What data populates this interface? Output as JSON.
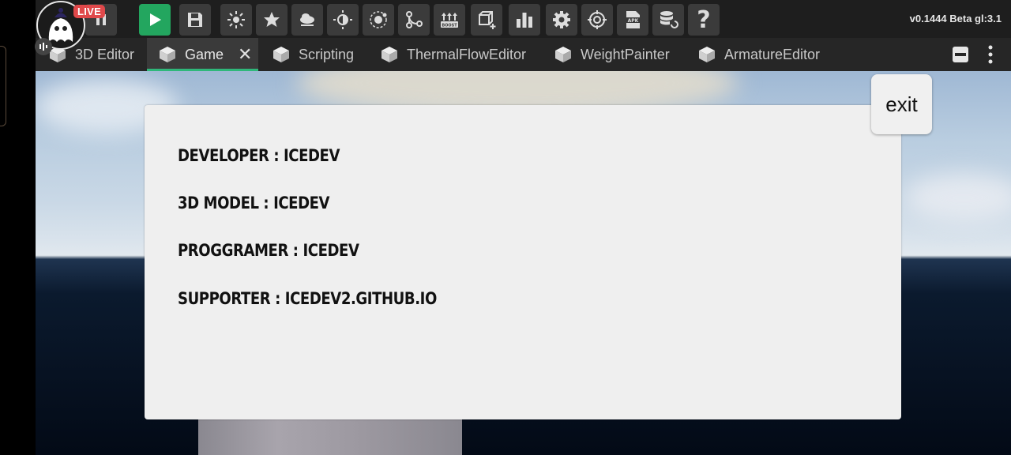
{
  "stream": {
    "live_label": "LIVE"
  },
  "toolbar": {
    "version": "v0.1444 Beta gl:3.1",
    "buttons": [
      {
        "name": "pause-icon"
      },
      {
        "name": "play-icon"
      },
      {
        "name": "save-icon"
      },
      {
        "name": "sun-icon"
      },
      {
        "name": "star-icon"
      },
      {
        "name": "cloud-icon"
      },
      {
        "name": "brightness-icon"
      },
      {
        "name": "orbit-icon"
      },
      {
        "name": "graph-nodes-icon"
      },
      {
        "name": "boost-icon",
        "label": "BOOST"
      },
      {
        "name": "add-cube-icon"
      },
      {
        "name": "bar-chart-icon"
      },
      {
        "name": "settings-gear-icon"
      },
      {
        "name": "target-icon"
      },
      {
        "name": "apk-icon",
        "label": "APK"
      },
      {
        "name": "database-refresh-icon"
      },
      {
        "name": "help-icon",
        "label": "?"
      }
    ]
  },
  "tabs": [
    {
      "label": "3D Editor",
      "active": false
    },
    {
      "label": "Game",
      "active": true
    },
    {
      "label": "Scripting",
      "active": false
    },
    {
      "label": "ThermalFlowEditor",
      "active": false
    },
    {
      "label": "WeightPainter",
      "active": false
    },
    {
      "label": "ArmatureEditor",
      "active": false
    }
  ],
  "tab_close": "✕",
  "panel": {
    "lines": [
      "DEVELOPER : ICEDEV",
      "3D MODEL : ICEDEV",
      "PROGGRAMER : ICEDEV",
      "SUPPORTER : ICEDEV2.GITHUB.IO"
    ],
    "exit_label": "exit"
  },
  "colors": {
    "play_button": "#23a65f",
    "active_tab_underline": "#2fb77a",
    "live_badge": "#e0484a",
    "panel_bg": "#efefef"
  }
}
